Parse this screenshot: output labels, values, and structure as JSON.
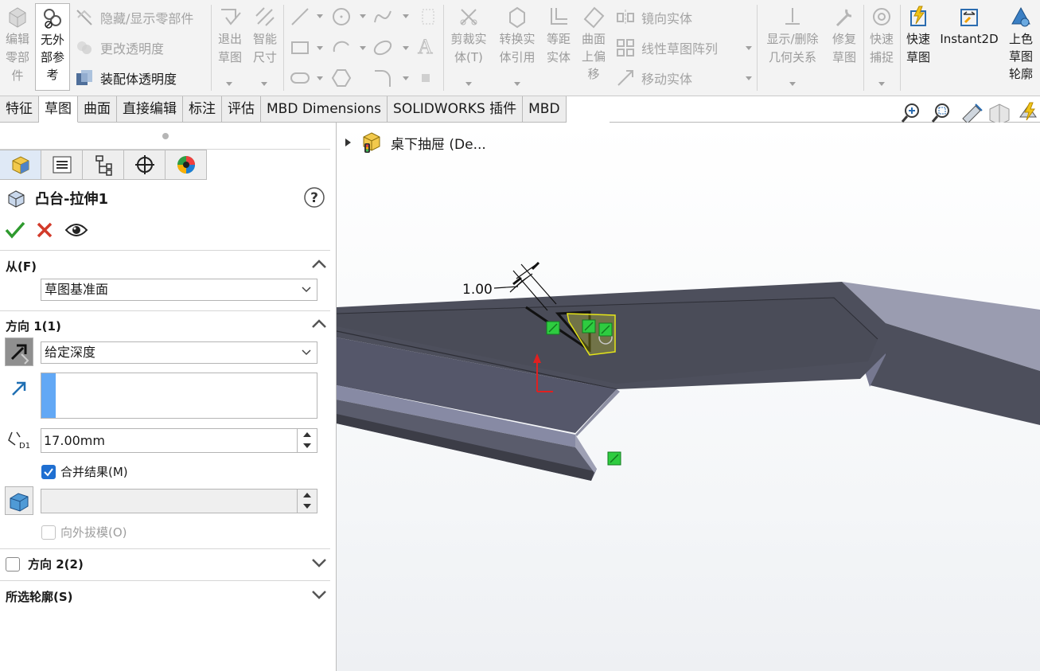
{
  "ribbon": {
    "edit_part": "编辑\n零部\n件",
    "no_external_refs": "无外\n部参\n考",
    "hide_show_parts": "隐藏/显示零部件",
    "change_transparency": "更改透明度",
    "assembly_transparency": "装配体透明度",
    "exit_sketch": "退出\n草图",
    "smart_dimension": "智能\n尺寸",
    "trim_entities": "剪裁实\n体(T)",
    "convert_entities": "转换实\n体引用",
    "offset_entities": "等距\n实体",
    "offset_on_surface": "曲面\n上偏\n移",
    "mirror_entities": "镜向实体",
    "linear_sketch_pattern": "线性草图阵列",
    "move_entities": "移动实体",
    "display_delete_relations": "显示/删除\n几何关系",
    "repair_sketch": "修复\n草图",
    "quick_snaps": "快速\n捕捉",
    "rapid_sketch": "快速\n草图",
    "instant2d": "Instant2D",
    "shaded_sketch_contours": "上色\n草图\n轮廓"
  },
  "tabs": [
    "特征",
    "草图",
    "曲面",
    "直接编辑",
    "标注",
    "评估",
    "MBD Dimensions",
    "SOLIDWORKS 插件",
    "MBD"
  ],
  "selected_tab": "草图",
  "property_manager": {
    "title": "凸台-拉伸1",
    "from": {
      "header": "从(F)",
      "value": "草图基准面"
    },
    "direction1": {
      "header": "方向 1(1)",
      "end_condition": "给定深度",
      "depth": "17.00mm",
      "depth_icon_label": "D1",
      "merge_result": "合并结果(M)",
      "merge_result_checked": true,
      "draft_outward": "向外拔模(O)",
      "draft_outward_checked": false
    },
    "direction2": {
      "header": "方向 2(2)",
      "checked": false
    },
    "selected_contours": {
      "header": "所选轮廓(S)"
    }
  },
  "feature_tree": {
    "root_label": "桌下抽屉 (De..."
  },
  "dimension_label": "1.00",
  "colors": {
    "accept": "#2e9a2e",
    "cancel": "#d23a2a",
    "selection_bar": "#62a8f5",
    "model_face": "#4d4f5c",
    "sketch_point": "#2ecc40",
    "highlight": "#e6e619"
  }
}
